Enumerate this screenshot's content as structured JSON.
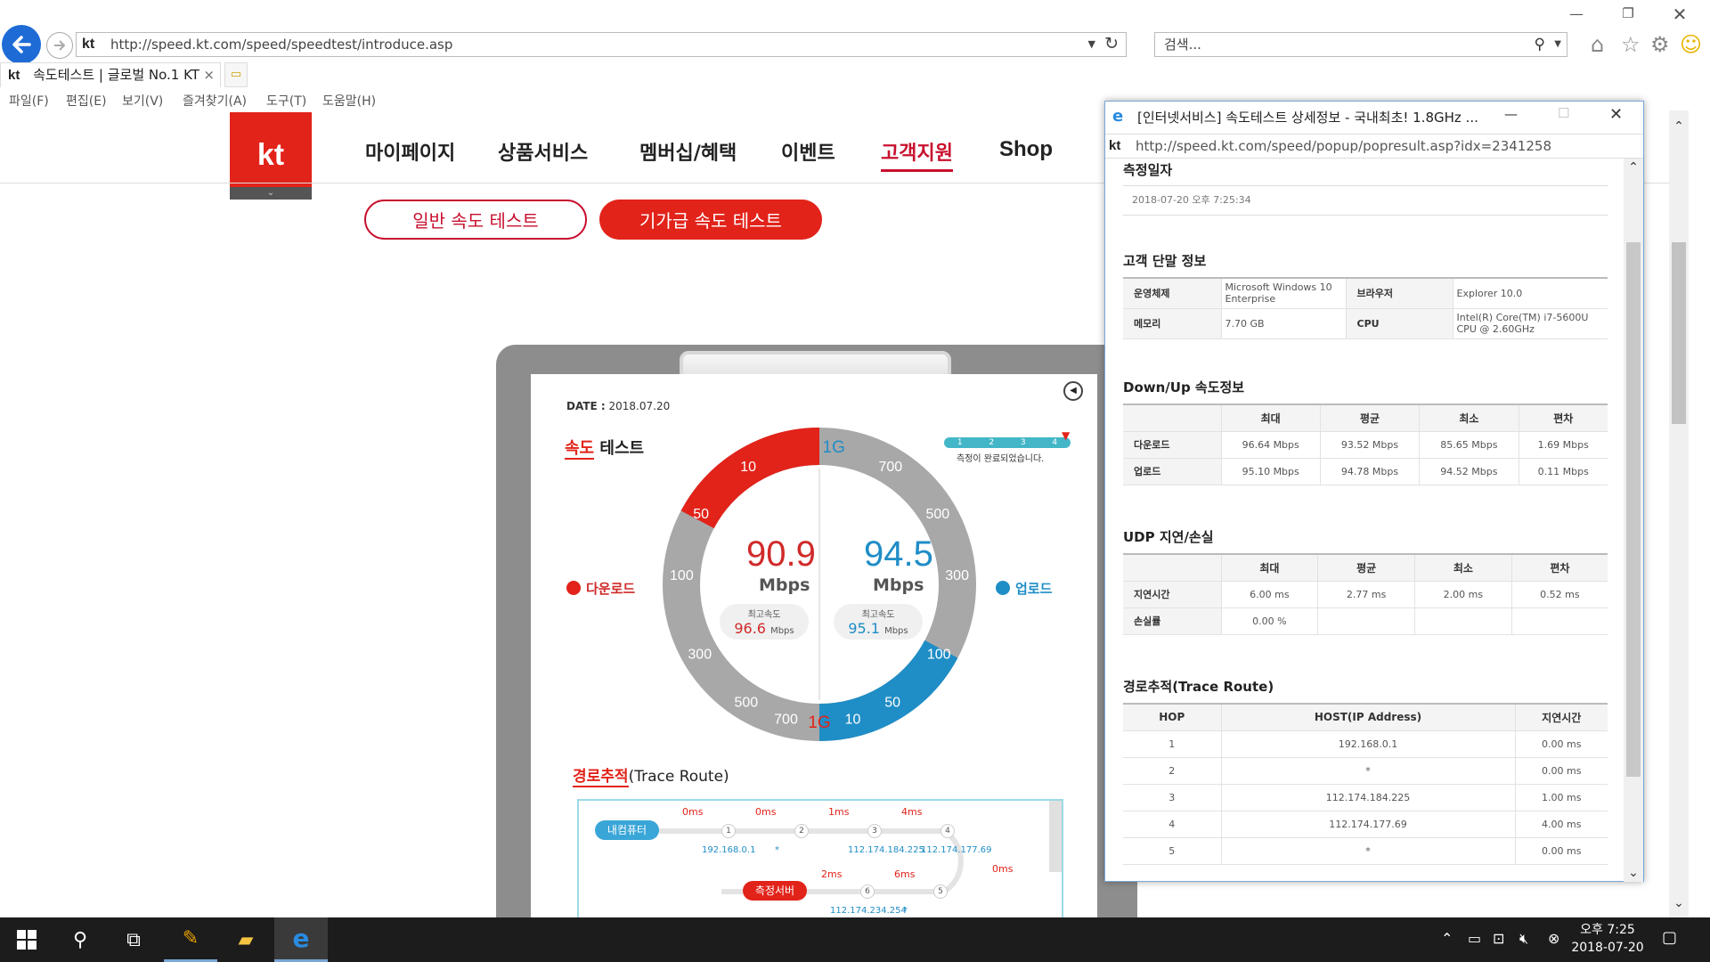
{
  "browser": {
    "url": "http://speed.kt.com/speed/speedtest/introduce.asp",
    "search_placeholder": "검색...",
    "tab_title": "속도테스트 | 글로벌 No.1 KT",
    "tab_close": "×",
    "menu": [
      "파일(F)",
      "편집(E)",
      "보기(V)",
      "즐겨찾기(A)",
      "도구(T)",
      "도움말(H)"
    ],
    "favicon_text": "kt"
  },
  "site": {
    "logo": "kt",
    "nav": [
      "마이페이지",
      "상품서비스",
      "멤버십/혜택",
      "이벤트",
      "고객지원",
      "Shop"
    ],
    "active_nav": "고객지원",
    "btn_normal": "일반 속도 테스트",
    "btn_giga": "기가급 속도 테스트",
    "accent_color": "#e2231a"
  },
  "speedtest": {
    "date_label": "DATE :",
    "date_value": "2018.07.20",
    "title_prefix": "속도",
    "title_suffix": " 테스트",
    "progress_steps": [
      "1",
      "2",
      "3",
      "4"
    ],
    "progress_text": "측정이 완료되었습니다.",
    "download_label": "다운로드",
    "upload_label": "업로드",
    "download_value": "90.9",
    "upload_value": "94.5",
    "unit": "Mbps",
    "max_label": "최고속도",
    "download_max": "96.6",
    "upload_max": "95.1",
    "gauge_left_ticks": [
      "10",
      "50",
      "100",
      "300",
      "500",
      "700",
      "1G"
    ],
    "gauge_right_ticks": [
      "1G",
      "700",
      "500",
      "300",
      "100",
      "50",
      "10"
    ],
    "download_color": "#e2231a",
    "upload_color": "#1f8dc6"
  },
  "trace_route": {
    "title_prefix": "경로추적",
    "title_suffix": "(Trace Route)",
    "start_label": "내컴퓨터",
    "end_label": "측정서버",
    "top_times": [
      "0ms",
      "0ms",
      "1ms",
      "4ms"
    ],
    "top_hops": [
      "1",
      "2",
      "3",
      "4"
    ],
    "top_hosts": [
      "192.168.0.1",
      "*",
      "112.174.184.225",
      "112.174.177.69"
    ],
    "turn_time": "0ms",
    "bottom_times": [
      "2ms",
      "6ms"
    ],
    "bottom_hops": [
      "6",
      "5"
    ],
    "bottom_hosts": [
      "112.174.234.254",
      "*"
    ]
  },
  "popup": {
    "title": "[인터넷서비스] 속도테스트 상세정보 - 국내최초! 1.8GHz ...",
    "url": "http://speed.kt.com/speed/popup/popresult.asp?idx=2341258",
    "measure_date_title": "측정일자",
    "measure_date": "2018-07-20 오후 7:25:34",
    "device_title": "고객 단말 정보",
    "device": {
      "os_label": "운영체제",
      "os": "Microsoft Windows 10 Enterprise",
      "browser_label": "브라우저",
      "browser": "Explorer 10.0",
      "memory_label": "메모리",
      "memory": "7.70 GB",
      "cpu_label": "CPU",
      "cpu": "Intel(R) Core(TM) i7-5600U CPU @ 2.60GHz"
    },
    "speed_title": "Down/Up 속도정보",
    "speed_headers": [
      "최대",
      "평균",
      "최소",
      "편차"
    ],
    "speed_rows": [
      {
        "label": "다운로드",
        "cells": [
          "96.64 Mbps",
          "93.52 Mbps",
          "85.65 Mbps",
          "1.69 Mbps"
        ]
      },
      {
        "label": "업로드",
        "cells": [
          "95.10 Mbps",
          "94.78 Mbps",
          "94.52 Mbps",
          "0.11 Mbps"
        ]
      }
    ],
    "udp_title": "UDP 지연/손실",
    "udp_headers": [
      "최대",
      "평균",
      "최소",
      "편차"
    ],
    "udp_rows": [
      {
        "label": "지연시간",
        "cells": [
          "6.00 ms",
          "2.77 ms",
          "2.00 ms",
          "0.52 ms"
        ]
      },
      {
        "label": "손실률",
        "cells": [
          "0.00 %",
          "",
          "",
          ""
        ]
      }
    ],
    "trace_title": "경로추적(Trace Route)",
    "trace_headers": [
      "HOP",
      "HOST(IP Address)",
      "지연시간"
    ],
    "trace_rows": [
      [
        "1",
        "192.168.0.1",
        "0.00 ms"
      ],
      [
        "2",
        "*",
        "0.00 ms"
      ],
      [
        "3",
        "112.174.184.225",
        "1.00 ms"
      ],
      [
        "4",
        "112.174.177.69",
        "4.00 ms"
      ],
      [
        "5",
        "*",
        "0.00 ms"
      ]
    ]
  },
  "taskbar": {
    "time": "오후 7:25",
    "date": "2018-07-20"
  }
}
